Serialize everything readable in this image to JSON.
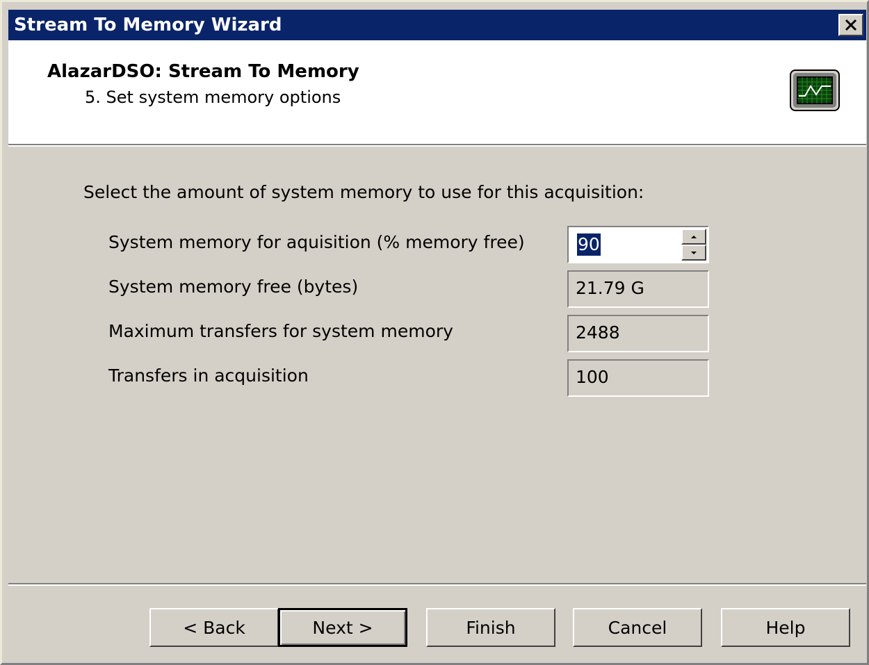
{
  "window": {
    "title": "Stream To Memory Wizard",
    "close_glyph": "✕"
  },
  "header": {
    "title": "AlazarDSO: Stream To Memory",
    "subtitle": "5. Set system memory options",
    "icon": "oscilloscope-icon"
  },
  "body": {
    "instruction": "Select the amount of system memory to use for this acquisition:",
    "rows": [
      {
        "label": "System memory for aquisition (% memory free)",
        "value": "90",
        "type": "spin"
      },
      {
        "label": "System memory free (bytes)",
        "value": "21.79 G",
        "type": "readonly"
      },
      {
        "label": "Maximum transfers for system memory",
        "value": "2488",
        "type": "readonly"
      },
      {
        "label": "Transfers in acquisition",
        "value": "100",
        "type": "readonly"
      }
    ]
  },
  "buttons": {
    "back": "< Back",
    "next": "Next >",
    "finish": "Finish",
    "cancel": "Cancel",
    "help": "Help"
  },
  "colors": {
    "titlebar": "#0a246a",
    "dialog": "#d4d0c8",
    "selection": "#0a246a"
  }
}
